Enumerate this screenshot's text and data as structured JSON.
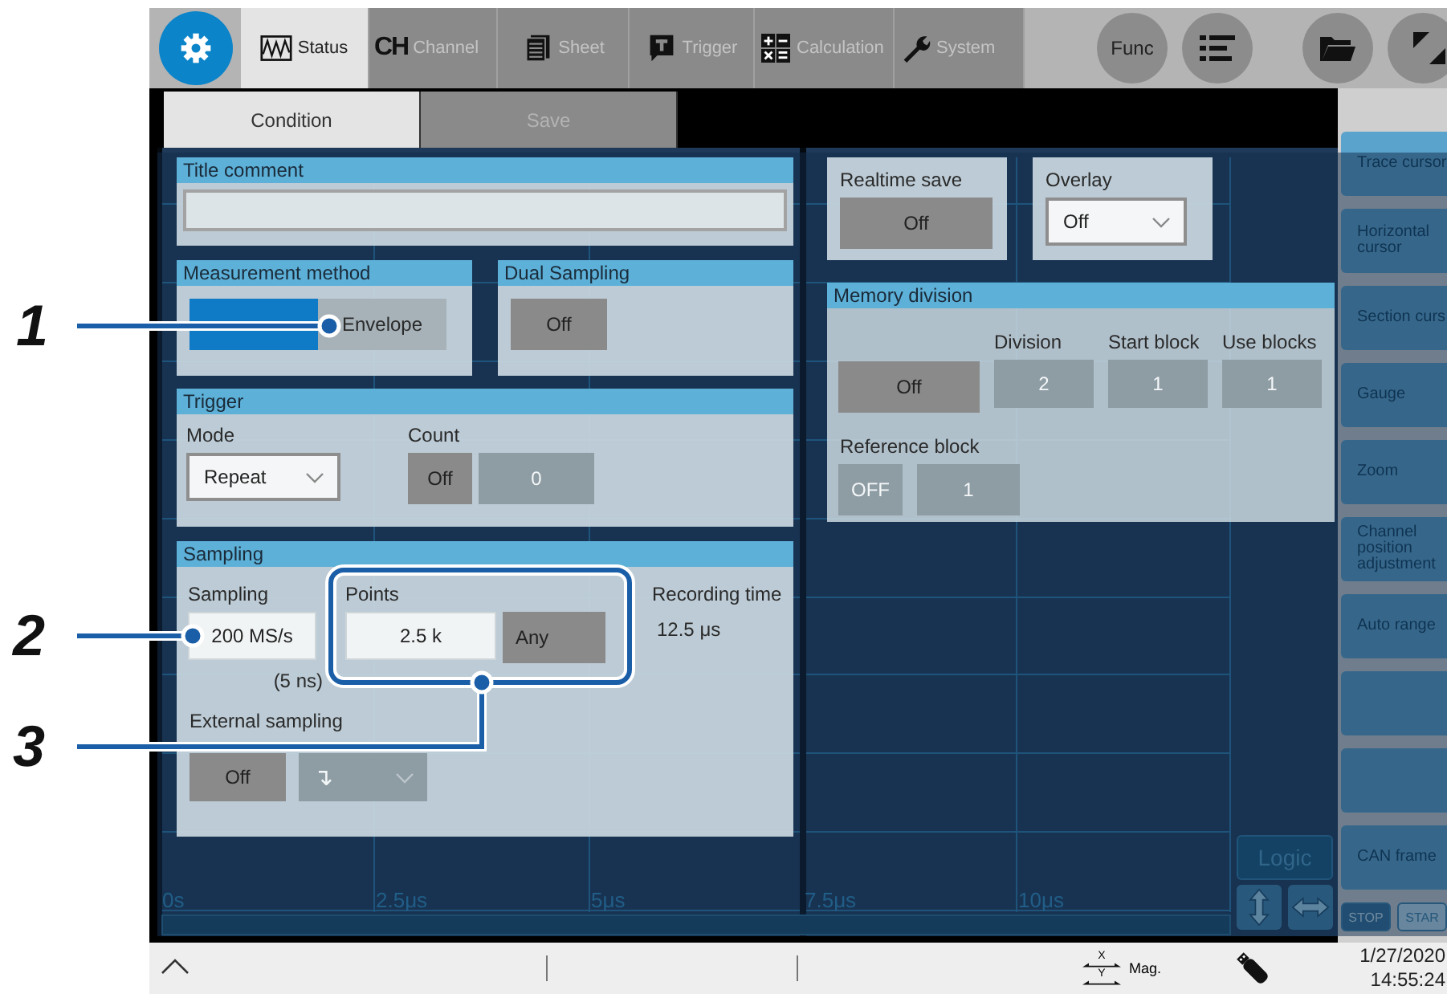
{
  "toolbar": {
    "tabs": [
      {
        "label": "Status",
        "selected": true
      },
      {
        "badge": "CH",
        "label": "Channel",
        "selected": false
      },
      {
        "label": "Sheet",
        "selected": false
      },
      {
        "label": "Trigger",
        "selected": false
      },
      {
        "label": "Calculation",
        "selected": false
      },
      {
        "label": "System",
        "selected": false
      }
    ],
    "func_button": "Func"
  },
  "subtabs": [
    {
      "label": "Condition",
      "selected": true
    },
    {
      "label": "Save",
      "selected": false
    }
  ],
  "graph": {
    "x_labels": [
      "0s",
      "2.5μs",
      "5μs",
      "7.5μs",
      "10μs"
    ],
    "logic_button": "Logic"
  },
  "side_buttons": [
    {
      "kind": "text",
      "label": "Trace cursor"
    },
    {
      "kind": "text",
      "label": "Horizontal cursor"
    },
    {
      "kind": "text",
      "label": "Section curs"
    },
    {
      "kind": "text",
      "label": "Gauge"
    },
    {
      "kind": "text",
      "label": "Zoom"
    },
    {
      "kind": "text",
      "label": "Channel position adjustment"
    },
    {
      "kind": "text",
      "label": "Auto range"
    },
    {
      "kind": "blank"
    },
    {
      "kind": "blank"
    },
    {
      "kind": "text",
      "label": "CAN frame"
    }
  ],
  "run_buttons": [
    {
      "label": "STOP",
      "selected": true
    },
    {
      "label": "STAR",
      "selected": false
    }
  ],
  "title_comment": {
    "title": "Title comment"
  },
  "measurement_method": {
    "title": "Measurement method",
    "options": [
      {
        "selected": true
      },
      {
        "label": "Envelope",
        "selected": false
      }
    ]
  },
  "dual_sampling": {
    "title": "Dual Sampling",
    "button": "Off"
  },
  "trigger": {
    "title": "Trigger",
    "mode_label": "Mode",
    "mode": "Repeat",
    "count_label": "Count",
    "count_button": "Off",
    "count_value": "0",
    "count_disabled": true
  },
  "sampling": {
    "title": "Sampling",
    "sampling_label": "Sampling",
    "sampling_value": "200 MS/s",
    "period": "(5 ns)",
    "points_label": "Points",
    "points_value": "2.5 k",
    "points_button": "Any",
    "recording_label": "Recording time",
    "recording_value": "12.5 μs",
    "external_label": "External sampling",
    "external_button": "Off",
    "slope": "↴",
    "slope_disabled": true
  },
  "realtime_save": {
    "title": "Realtime save",
    "button": "Off"
  },
  "overlay": {
    "title": "Overlay",
    "value": "Off"
  },
  "memory_division": {
    "title": "Memory division",
    "button": "Off",
    "fields": [
      {
        "label": "Division",
        "value": "2",
        "disabled": true
      },
      {
        "label": "Start block",
        "value": "1",
        "disabled": true
      },
      {
        "label": "Use blocks",
        "value": "1",
        "disabled": true
      }
    ],
    "reference_label": "Reference block",
    "reference_button": "OFF",
    "reference_disabled": true,
    "reference_value": "1"
  },
  "callouts": [
    {
      "number": "1"
    },
    {
      "number": "2"
    },
    {
      "number": "3"
    }
  ],
  "status_bar": {
    "mag_x": "X",
    "mag_y": "Y",
    "mag_label": "Mag.",
    "date": "1/27/2020",
    "time": "14:55:24"
  }
}
